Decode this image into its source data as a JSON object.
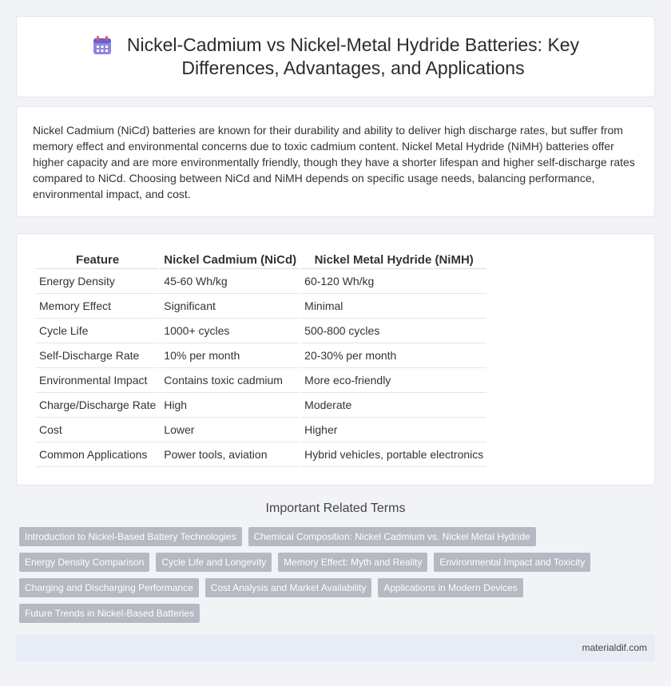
{
  "header": {
    "title_line1": "Nickel-Cadmium vs Nickel-Metal Hydride Batteries: Key",
    "title_line2": "Differences, Advantages, and Applications",
    "icon": "calendar-icon"
  },
  "intro": {
    "text": "Nickel Cadmium (NiCd) batteries are known for their durability and ability to deliver high discharge rates, but suffer from memory effect and environmental concerns due to toxic cadmium content. Nickel Metal Hydride (NiMH) batteries offer higher capacity and are more environmentally friendly, though they have a shorter lifespan and higher self-discharge rates compared to NiCd. Choosing between NiCd and NiMH depends on specific usage needs, balancing performance, environmental impact, and cost."
  },
  "table": {
    "headers": [
      "Feature",
      "Nickel Cadmium (NiCd)",
      "Nickel Metal Hydride (NiMH)"
    ],
    "rows": [
      [
        "Energy Density",
        "45-60 Wh/kg",
        "60-120 Wh/kg"
      ],
      [
        "Memory Effect",
        "Significant",
        "Minimal"
      ],
      [
        "Cycle Life",
        "1000+ cycles",
        "500-800 cycles"
      ],
      [
        "Self-Discharge Rate",
        "10% per month",
        "20-30% per month"
      ],
      [
        "Environmental Impact",
        "Contains toxic cadmium",
        "More eco-friendly"
      ],
      [
        "Charge/Discharge Rate",
        "High",
        "Moderate"
      ],
      [
        "Cost",
        "Lower",
        "Higher"
      ],
      [
        "Common Applications",
        "Power tools, aviation",
        "Hybrid vehicles, portable electronics"
      ]
    ]
  },
  "related": {
    "heading": "Important Related Terms",
    "tags": [
      [
        "Introduction to Nickel-Based Battery Technologies",
        "Chemical Composition: Nickel Cadmium vs. Nickel Metal Hydride"
      ],
      [
        "Energy Density Comparison",
        "Cycle Life and Longevity",
        "Memory Effect: Myth and Reality",
        "Environmental Impact and Toxicity"
      ],
      [
        "Charging and Discharging Performance",
        "Cost Analysis and Market Availability",
        "Applications in Modern Devices"
      ],
      [
        "Future Trends in Nickel-Based Batteries"
      ]
    ]
  },
  "footer": {
    "site": "materialdif.com"
  },
  "colors": {
    "tag_bg": "#b4b9c2",
    "icon_purple": "#7b6fd6",
    "icon_red": "#e35a5a"
  }
}
